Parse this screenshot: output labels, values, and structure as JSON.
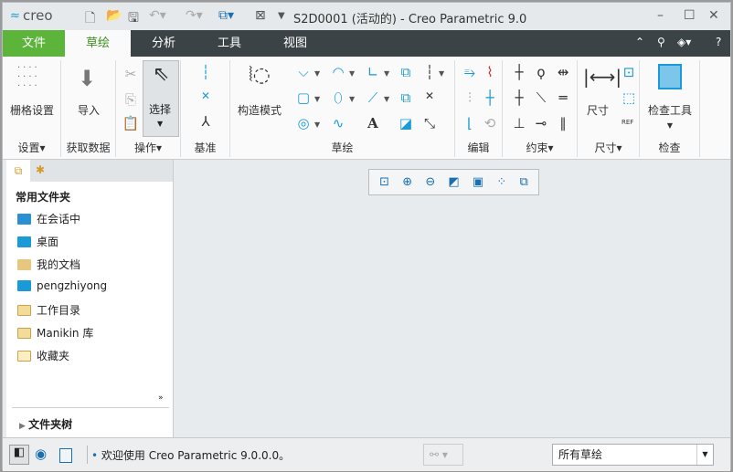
{
  "app": {
    "logo": "creo",
    "title": "S2D0001 (活动的) - Creo Parametric 9.0"
  },
  "tabs": [
    {
      "label": "文件"
    },
    {
      "label": "草绘"
    },
    {
      "label": "分析"
    },
    {
      "label": "工具"
    },
    {
      "label": "视图"
    }
  ],
  "ribbon": {
    "grid_settings": "栅格设置",
    "import": "导入",
    "select": "选择",
    "construction_mode": "构造模式",
    "dimension": "尺寸",
    "inspect_tool": "检查工具",
    "groups": {
      "settings": "设置",
      "get_data": "获取数据",
      "operations": "操作",
      "datum": "基准",
      "sketch": "草绘",
      "edit": "编辑",
      "constrain": "约束",
      "dimension": "尺寸",
      "inspect": "检查"
    },
    "text_icon": "A",
    "ref_label": "REF"
  },
  "left_panel": {
    "header": "常用文件夹",
    "items": [
      {
        "label": "在会话中",
        "icon": "monitor-icon"
      },
      {
        "label": "桌面",
        "icon": "desktop-icon"
      },
      {
        "label": "我的文档",
        "icon": "documents-icon"
      },
      {
        "label": "pengzhiyong",
        "icon": "user-icon"
      },
      {
        "label": "工作目录",
        "icon": "working-dir-icon"
      },
      {
        "label": "Manikin 库",
        "icon": "folder-icon"
      },
      {
        "label": "收藏夹",
        "icon": "favorites-icon"
      }
    ],
    "folder_tree": "文件夹树"
  },
  "status": {
    "message": "欢迎使用 Creo Parametric 9.0.0.0。",
    "filter": "所有草绘"
  },
  "colors": {
    "accent_green": "#5cb43a",
    "tab_bar": "#3c4346",
    "icon_blue": "#1a9ad6"
  }
}
